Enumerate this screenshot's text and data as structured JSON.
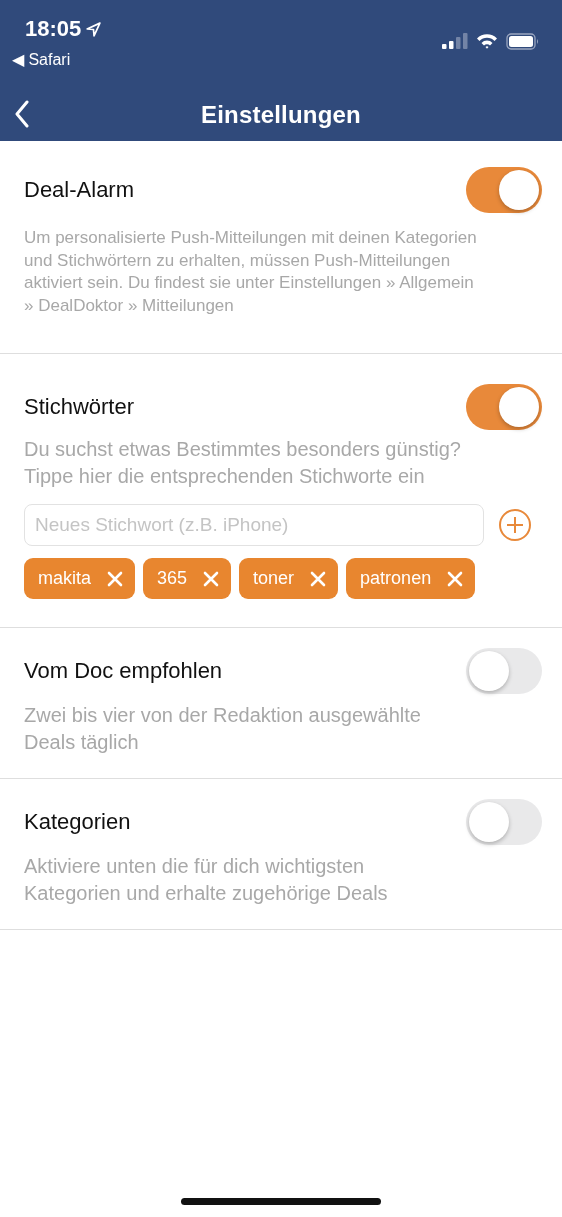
{
  "status_bar": {
    "time": "18:05",
    "back_app": "◀ Safari"
  },
  "nav": {
    "title": "Einstellungen"
  },
  "sections": [
    {
      "kind": "alarm",
      "title": "Deal-Alarm",
      "on": true,
      "description": "Um personalisierte Push-Mitteilungen mit deinen Kategorien und Stichwörtern zu erhalten, müssen Push-Mitteilungen aktiviert sein. Du findest sie unter Einstellungen » Allgemein » DealDoktor » Mitteilungen"
    },
    {
      "kind": "keywords",
      "title": "Stichwörter",
      "on": true,
      "description": "Du suchst etwas Bestimmtes besonders günstig? Tippe hier die entsprechenden Stichworte ein",
      "placeholder": "Neues Stichwort (z.B. iPhone)",
      "tags": [
        "makita",
        "365",
        "toner",
        "patronen"
      ]
    },
    {
      "kind": "plain",
      "title": "Vom Doc empfohlen",
      "on": false,
      "description": "Zwei bis vier von der Redaktion ausgewählte Deals täglich"
    },
    {
      "kind": "plain",
      "title": "Kategorien",
      "on": false,
      "description": "Aktiviere unten die für dich wichtigsten Kategorien und erhalte zugehörige Deals"
    }
  ]
}
